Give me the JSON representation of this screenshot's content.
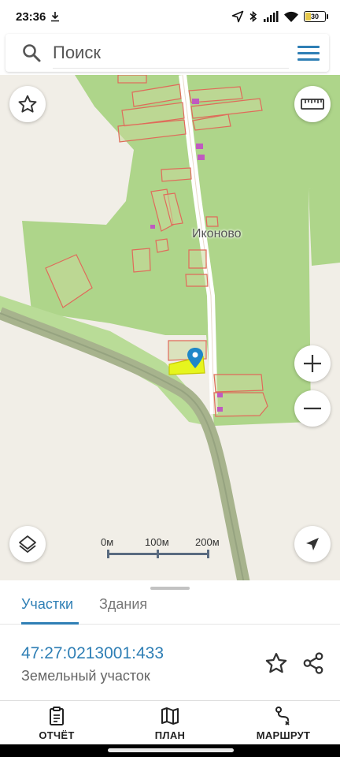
{
  "status_bar": {
    "time": "23:36",
    "battery": "30",
    "battery_level": 0.3
  },
  "search": {
    "placeholder": "Поиск"
  },
  "map": {
    "place_label": "Иконово",
    "scale_labels": [
      "0м",
      "100м",
      "200м"
    ],
    "colors": {
      "background": "#f1eee7",
      "green_area": "#aed58a",
      "parcel_outline": "#e06a5a",
      "selected_parcel": "#e6f51e",
      "marker": "#1f86c8",
      "road": "#a7b38d"
    }
  },
  "sheet": {
    "tabs": [
      "Участки",
      "Здания"
    ],
    "active_tab": "Участки",
    "parcel_number": "47:27:0213001:433",
    "parcel_type": "Земельный участок"
  },
  "bottom_nav": {
    "items": [
      {
        "label": "ОТЧЁТ",
        "icon": "clipboard-icon"
      },
      {
        "label": "ПЛАН",
        "icon": "map-icon"
      },
      {
        "label": "МАРШРУТ",
        "icon": "route-icon"
      }
    ]
  }
}
